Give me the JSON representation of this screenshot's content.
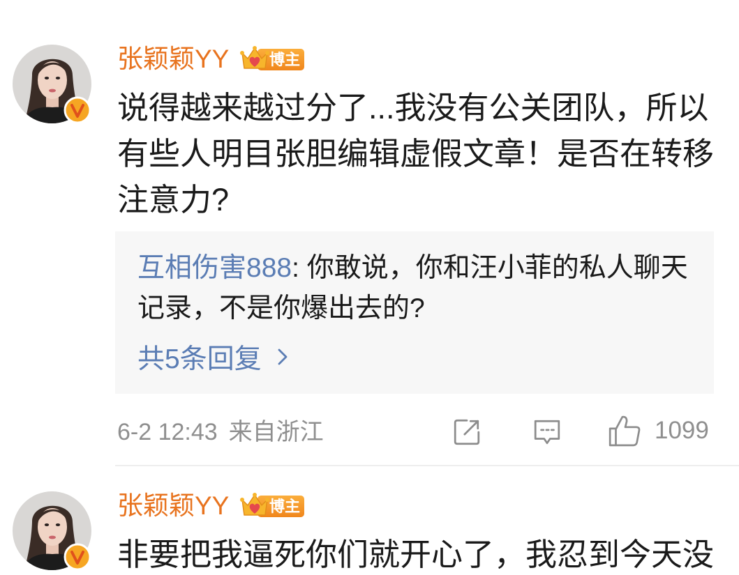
{
  "colors": {
    "username": "#E8731E",
    "link": "#5B7DB4",
    "text": "#1A1A1A",
    "meta": "#8F8F8F",
    "quote-bg": "#F7F7F7",
    "divider": "#EEEEEE",
    "icon": "#8C8C8C",
    "badge-top": "#FBAE3C",
    "badge-bottom": "#F0861C",
    "verified": "#F6A623",
    "verified-mark": "#E0511C"
  },
  "comments": [
    {
      "avatar_icon": "user-avatar-photo",
      "verified_icon": "verified-v-icon",
      "username": "张颖颖YY",
      "role_badge": {
        "icon": "crown-icon",
        "label": "博主"
      },
      "text_lines": [
        "说得越来越过分了...我没有公关团队，所以",
        "有些人明目张胆编辑虚假文章！是否在转移",
        "注意力?"
      ],
      "reply_preview": {
        "author": "互相伤害888",
        "lines": [
          ": 你敢说，你和汪小菲的私人聊天",
          "记录，不是你爆出去的?"
        ],
        "more_replies_label": "共5条回复",
        "more_icon": "chevron-right-icon"
      },
      "meta": {
        "time": "6-2 12:43",
        "location": "来自浙江"
      },
      "actions": {
        "share_icon": "share-icon",
        "comment_icon": "comment-icon",
        "like_icon": "thumbs-up-icon",
        "like_count": "1099"
      }
    },
    {
      "avatar_icon": "user-avatar-photo",
      "verified_icon": "verified-v-icon",
      "username": "张颖颖YY",
      "role_badge": {
        "icon": "crown-icon",
        "label": "博主"
      },
      "text_lines": [
        "非要把我逼死你们就开心了，我忍到今天没"
      ]
    }
  ]
}
